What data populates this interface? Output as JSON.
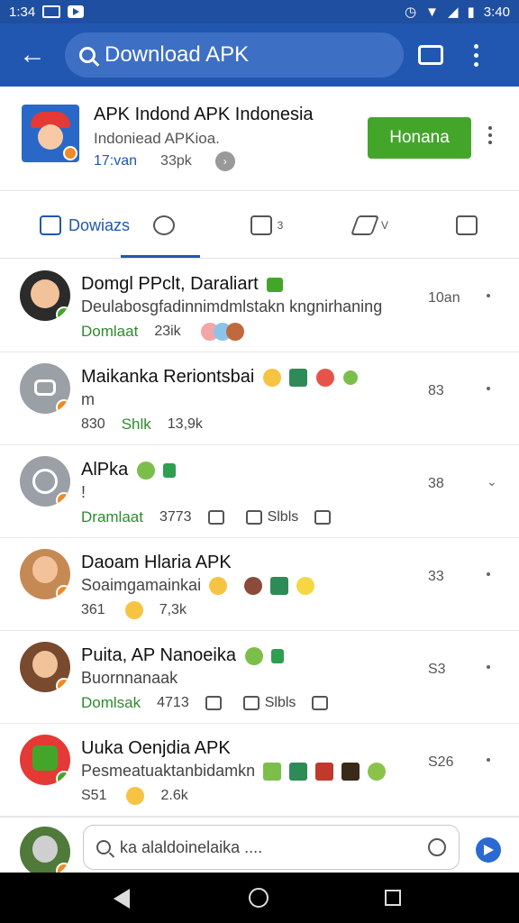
{
  "status_bar": {
    "time_left": "1:34",
    "time_right": "3:40"
  },
  "app_bar": {
    "search_text": "Download APK"
  },
  "app_card": {
    "name": "APK Indond APK Indonesia",
    "subtitle": "Indoniead APKioa.",
    "rating": "17:van",
    "size": "33pk",
    "install_label": "Honana"
  },
  "tabs": [
    {
      "label": "Dowiazs"
    },
    {
      "label": ""
    },
    {
      "label": "3"
    },
    {
      "label": "V"
    },
    {
      "label": ""
    }
  ],
  "list": [
    {
      "title": "Domgl PPclt, Daraliart",
      "subtitle": "Deulabosgfadinnimdmlstakn kngnirhaning",
      "action": "Domlaat",
      "meta1": "23ik",
      "count": "10an",
      "avatar_color": "#2b2b2b",
      "badge_color": "#43a62b"
    },
    {
      "title": "Maikanka Reriontsbai",
      "subtitle": "m",
      "action": "Shlk",
      "pre_action": "830",
      "meta1": "13,9k",
      "count": "83",
      "avatar_color": "#9aa0a6",
      "badge_color": "#f08a24"
    },
    {
      "title": "AlPka",
      "subtitle": "!",
      "action": "Dramlaat",
      "meta1": "3773",
      "meta2": "Slbls",
      "count": "38",
      "avatar_color": "#9aa0a6",
      "badge_color": "#f08a24"
    },
    {
      "title": "Daoam Hlaria APK",
      "subtitle": "Soaimgamainkai",
      "pre_action": "361",
      "meta1": "7,3k",
      "count": "33",
      "avatar_color": "#c58a54",
      "badge_color": "#f08a24"
    },
    {
      "title": "Puita, AP Nanoeika",
      "subtitle": "Buornnanaak",
      "action": "Domlsak",
      "meta1": "4713",
      "meta2": "Slbls",
      "count": "S3",
      "avatar_color": "#7a4a2e",
      "badge_color": "#f08a24"
    },
    {
      "title": "Uuka Oenjdia APK",
      "subtitle": "Pesmeatuaktanbidamkn",
      "pre_action": "S51",
      "meta1": "2.6k",
      "count": "S26",
      "avatar_color": "#e53935",
      "badge_color": "#43a62b"
    }
  ],
  "compose": {
    "placeholder": "ka alaldoinelaika ...."
  }
}
